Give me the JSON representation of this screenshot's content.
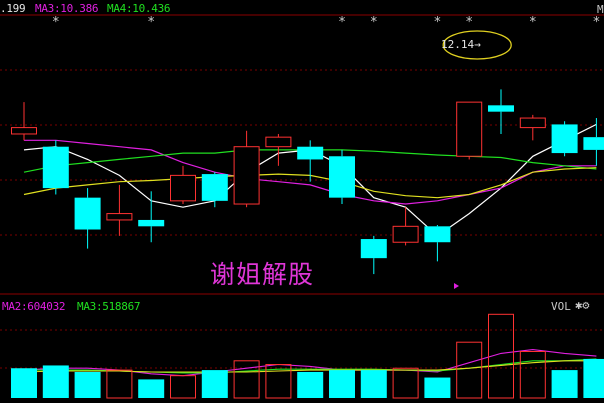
{
  "header_top": {
    "ma2_value": ".199",
    "ma3": {
      "label": "MA3:10.386",
      "color": "#e020e0"
    },
    "ma4": {
      "label": "MA4:10.436",
      "color": "#20e020"
    },
    "corner_text": "M"
  },
  "header_volume": {
    "ma2": {
      "label": "MA2:604032",
      "color": "#e020e0"
    },
    "ma3": {
      "label": "MA3:518867",
      "color": "#20e020"
    },
    "vol_label": "VOL",
    "icons": [
      "settings-icon",
      "gear-icon"
    ]
  },
  "watermark": "谢姐解股",
  "price_annotation": "12.14",
  "chart_data": [
    {
      "type": "candlestick",
      "title": "",
      "colors": {
        "up": "#ff3232",
        "down": "#00ffff",
        "ma_white": "#ffffff",
        "ma_magenta": "#e020e0",
        "ma_green": "#20e020",
        "ma_yellow": "#e0e020"
      },
      "ylim": [
        8.6,
        12.4
      ],
      "candles": [
        {
          "open": 11.05,
          "close": 11.15,
          "high": 11.55,
          "low": 10.95
        },
        {
          "open": 10.85,
          "close": 10.2,
          "high": 10.95,
          "low": 10.1
        },
        {
          "open": 10.05,
          "close": 9.55,
          "high": 10.2,
          "low": 9.25
        },
        {
          "open": 9.7,
          "close": 9.8,
          "high": 10.25,
          "low": 9.45
        },
        {
          "open": 9.7,
          "close": 9.6,
          "high": 10.15,
          "low": 9.35
        },
        {
          "open": 10.0,
          "close": 10.4,
          "high": 10.55,
          "low": 9.95
        },
        {
          "open": 10.42,
          "close": 10.0,
          "high": 10.45,
          "low": 9.9
        },
        {
          "open": 9.95,
          "close": 10.85,
          "high": 11.1,
          "low": 9.9
        },
        {
          "open": 10.85,
          "close": 11.0,
          "high": 11.05,
          "low": 10.55
        },
        {
          "open": 10.85,
          "close": 10.65,
          "high": 10.95,
          "low": 10.3
        },
        {
          "open": 10.7,
          "close": 10.05,
          "high": 10.8,
          "low": 9.95
        },
        {
          "open": 9.4,
          "close": 9.1,
          "high": 9.45,
          "low": 8.85
        },
        {
          "open": 9.35,
          "close": 9.6,
          "high": 9.9,
          "low": 9.3
        },
        {
          "open": 9.6,
          "close": 9.35,
          "high": 9.62,
          "low": 9.05
        },
        {
          "open": 10.7,
          "close": 11.55,
          "high": 11.55,
          "low": 10.65
        },
        {
          "open": 11.5,
          "close": 11.4,
          "high": 11.75,
          "low": 11.05
        },
        {
          "open": 11.15,
          "close": 11.3,
          "high": 11.35,
          "low": 10.95
        },
        {
          "open": 11.2,
          "close": 10.75,
          "high": 11.25,
          "low": 10.7
        },
        {
          "open": 11.0,
          "close": 10.8,
          "high": 11.3,
          "low": 10.55
        }
      ],
      "ma_series": [
        {
          "color": "#ffffff",
          "values": [
            10.8,
            10.85,
            10.65,
            10.4,
            10.0,
            9.9,
            10.0,
            10.45,
            10.75,
            10.8,
            10.55,
            10.05,
            9.9,
            9.45,
            9.8,
            10.2,
            10.7,
            10.95,
            11.2
          ]
        },
        {
          "color": "#e020e0",
          "values": [
            10.95,
            10.95,
            10.9,
            10.85,
            10.8,
            10.6,
            10.45,
            10.35,
            10.3,
            10.25,
            10.1,
            10.0,
            9.95,
            10.0,
            10.1,
            10.2,
            10.45,
            10.55,
            10.55
          ]
        },
        {
          "color": "#20e020",
          "values": [
            10.45,
            10.55,
            10.6,
            10.65,
            10.7,
            10.75,
            10.75,
            10.8,
            10.8,
            10.8,
            10.8,
            10.78,
            10.75,
            10.72,
            10.7,
            10.68,
            10.6,
            10.55,
            10.5
          ]
        },
        {
          "color": "#e0e020",
          "values": [
            10.1,
            10.2,
            10.25,
            10.3,
            10.32,
            10.35,
            10.38,
            10.4,
            10.42,
            10.4,
            10.3,
            10.15,
            10.08,
            10.05,
            10.1,
            10.25,
            10.45,
            10.5,
            10.52
          ]
        }
      ],
      "markers": [
        1,
        4,
        10,
        11,
        13,
        14,
        16,
        18
      ],
      "annotation_index": 14
    },
    {
      "type": "bar",
      "title": "",
      "ylim": [
        0,
        100
      ],
      "values": [
        32,
        35,
        28,
        30,
        20,
        24,
        30,
        40,
        36,
        28,
        30,
        30,
        32,
        22,
        60,
        90,
        50,
        30,
        42
      ],
      "up": [
        false,
        false,
        false,
        true,
        false,
        true,
        false,
        true,
        true,
        false,
        false,
        false,
        true,
        false,
        true,
        true,
        true,
        false,
        false
      ],
      "ma_series": [
        {
          "color": "#e020e0",
          "values": [
            30,
            32,
            32,
            30,
            26,
            24,
            28,
            32,
            36,
            34,
            30,
            30,
            30,
            28,
            38,
            48,
            52,
            48,
            45
          ]
        },
        {
          "color": "#20e020",
          "values": [
            30,
            30,
            30,
            29,
            28,
            27,
            27,
            29,
            31,
            31,
            31,
            31,
            30,
            29,
            32,
            36,
            40,
            40,
            42
          ]
        },
        {
          "color": "#e0e020",
          "values": [
            28,
            29,
            29,
            29,
            28,
            28,
            28,
            28,
            29,
            30,
            30,
            30,
            30,
            30,
            32,
            35,
            38,
            40,
            40
          ]
        }
      ]
    }
  ]
}
